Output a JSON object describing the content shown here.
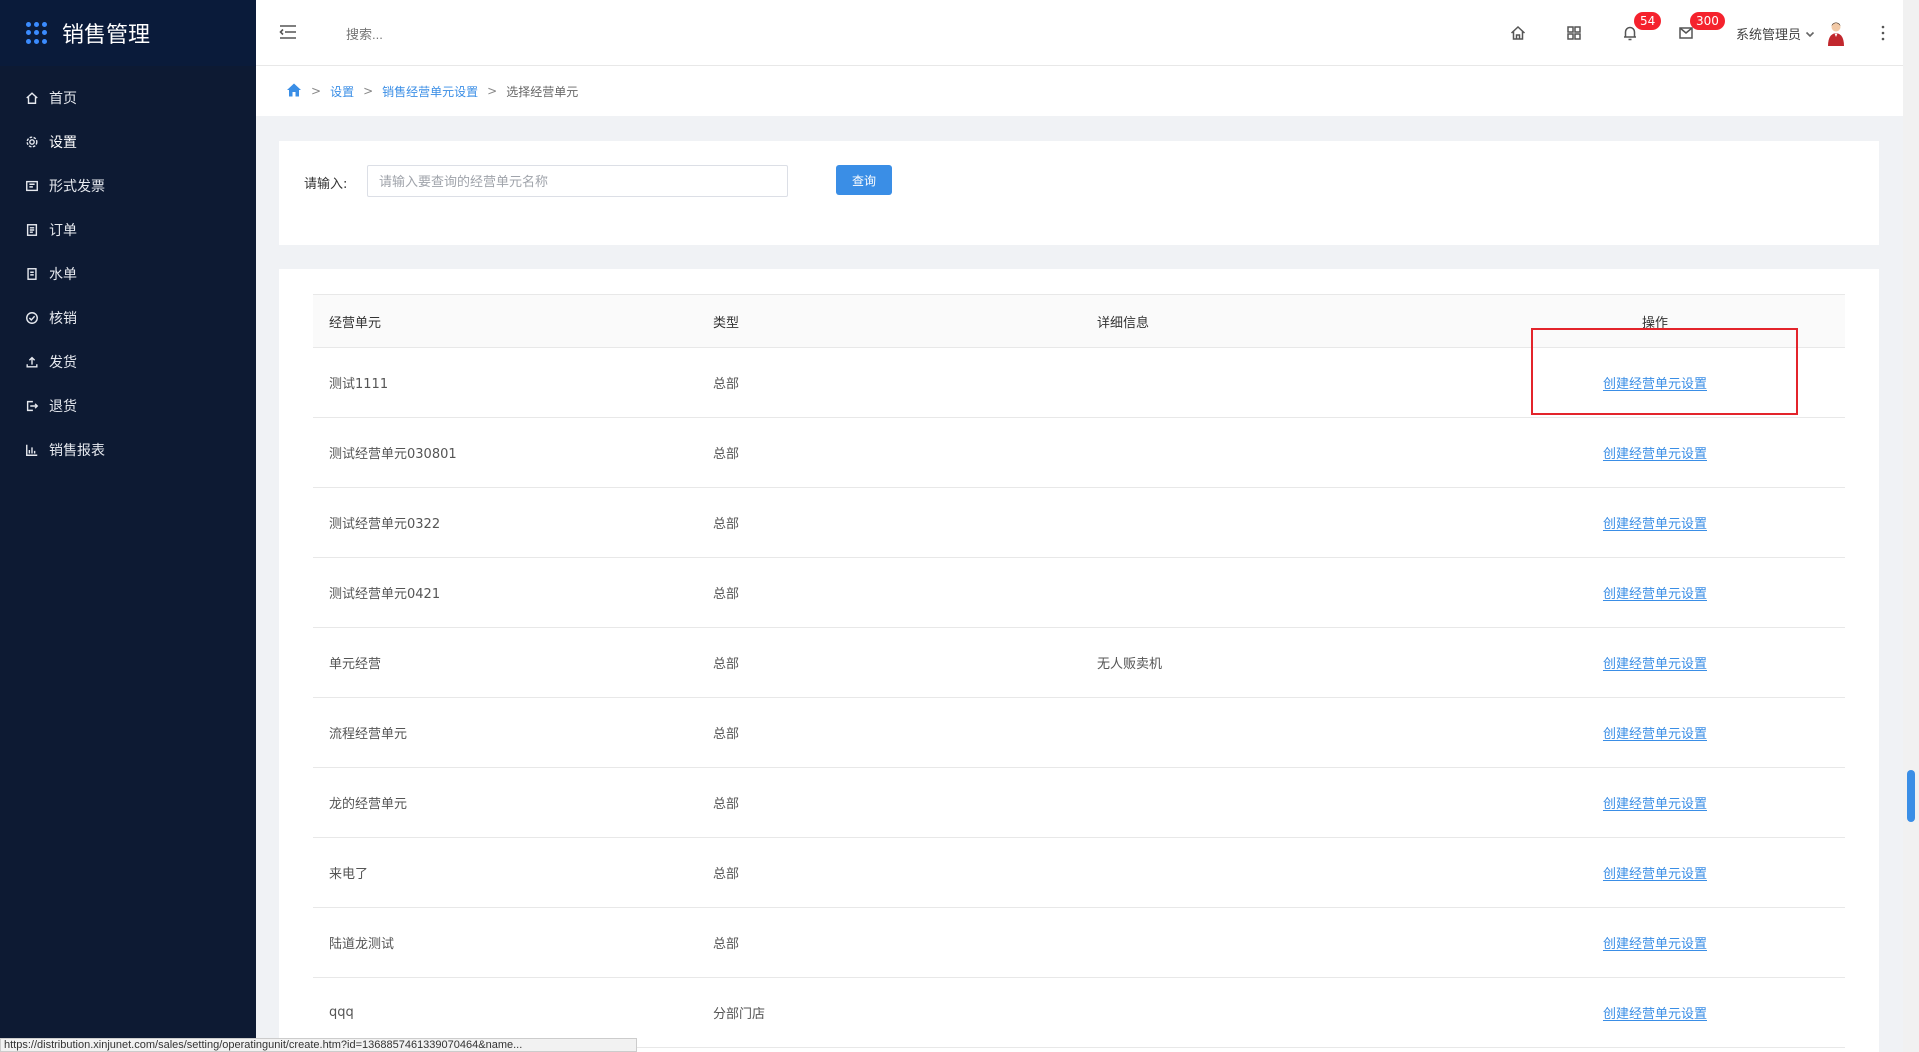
{
  "brand": {
    "title": "销售管理"
  },
  "sidebar": {
    "items": [
      {
        "label": "首页",
        "icon": "home-icon"
      },
      {
        "label": "设置",
        "icon": "gear-icon"
      },
      {
        "label": "形式发票",
        "icon": "invoice-icon"
      },
      {
        "label": "订单",
        "icon": "order-icon"
      },
      {
        "label": "水单",
        "icon": "receipt-icon"
      },
      {
        "label": "核销",
        "icon": "check-circle-icon"
      },
      {
        "label": "发货",
        "icon": "upload-icon"
      },
      {
        "label": "退货",
        "icon": "return-icon"
      },
      {
        "label": "销售报表",
        "icon": "bar-chart-icon"
      }
    ]
  },
  "header": {
    "search_placeholder": "搜索...",
    "notifications_count": "54",
    "messages_count": "300",
    "user_name": "系统管理员"
  },
  "breadcrumb": {
    "items": [
      "设置",
      "销售经营单元设置"
    ],
    "current": "选择经营单元"
  },
  "search": {
    "label": "请输入:",
    "placeholder": "请输入要查询的经营单元名称",
    "button_label": "查询"
  },
  "table": {
    "headers": [
      "经营单元",
      "类型",
      "详细信息",
      "操作"
    ],
    "rows": [
      {
        "unit": "测试1111",
        "type": "总部",
        "detail": "",
        "action": "创建经营单元设置"
      },
      {
        "unit": "测试经营单元030801",
        "type": "总部",
        "detail": "",
        "action": "创建经营单元设置"
      },
      {
        "unit": "测试经营单元0322",
        "type": "总部",
        "detail": "",
        "action": "创建经营单元设置"
      },
      {
        "unit": "测试经营单元0421",
        "type": "总部",
        "detail": "",
        "action": "创建经营单元设置"
      },
      {
        "unit": "单元经营",
        "type": "总部",
        "detail": "无人贩卖机",
        "action": "创建经营单元设置"
      },
      {
        "unit": "流程经营单元",
        "type": "总部",
        "detail": "",
        "action": "创建经营单元设置"
      },
      {
        "unit": "龙的经营单元",
        "type": "总部",
        "detail": "",
        "action": "创建经营单元设置"
      },
      {
        "unit": "来电了",
        "type": "总部",
        "detail": "",
        "action": "创建经营单元设置"
      },
      {
        "unit": "陆道龙测试",
        "type": "总部",
        "detail": "",
        "action": "创建经营单元设置"
      },
      {
        "unit": "qqq",
        "type": "分部门店",
        "detail": "",
        "action": "创建经营单元设置"
      }
    ]
  },
  "statusbar": {
    "url": "https://distribution.xinjunet.com/sales/setting/operatingunit/create.htm?id=1368857461339070464&name..."
  },
  "colors": {
    "sidebar_bg": "#0d1a33",
    "accent": "#3a8ee6",
    "badge": "#f5222d",
    "highlight": "#e3242b"
  }
}
